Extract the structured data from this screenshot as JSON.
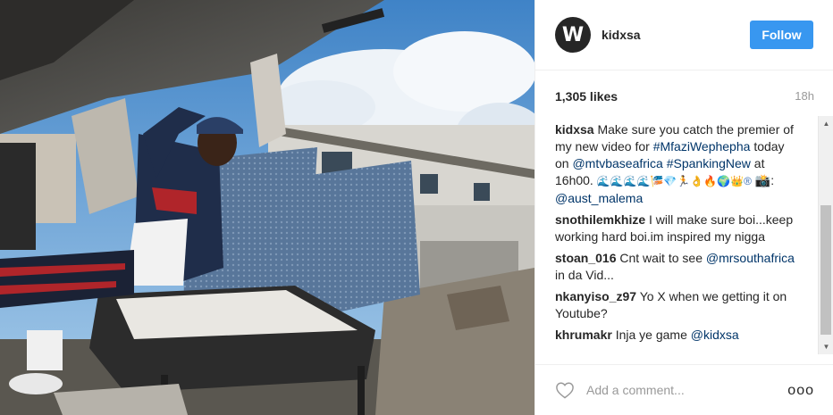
{
  "post": {
    "username": "kidxsa",
    "avatar_letter": "W",
    "follow_label": "Follow",
    "likes": "1,305 likes",
    "time": "18h"
  },
  "caption": {
    "author": "kidxsa",
    "text_1": "Make sure you catch the premier of my new video for",
    "hashtag_1": "#MfaziWephepha",
    "text_2": "today on",
    "mention_1": "@mtvbaseafrica",
    "hashtag_2": "#SpankingNew",
    "text_3": "at 16h00.",
    "emoji_text": "🌊🌊🌊🌊🎏💎🏃👌🔥🌍👑®",
    "text_4": "📸:",
    "mention_2": "@aust_malema"
  },
  "comments": [
    {
      "author": "snothilemkhize",
      "text": "I will make sure boi...keep working hard boi.im inspired my nigga"
    },
    {
      "author": "stoan_016",
      "text": "Cnt wait to see",
      "mention": "@mrsouthafrica",
      "text_after": "in da Vid..."
    },
    {
      "author": "nkanyiso_z97",
      "text": "Yo X when we getting it on Youtube?"
    },
    {
      "author": "khrumakr",
      "text": "Inja ye game",
      "mention": "@kidxsa"
    }
  ],
  "composer": {
    "placeholder": "Add a comment...",
    "heart_icon": "heart-outline-icon",
    "more_icon": "more-options-icon",
    "more_glyph": "ooo"
  },
  "colors": {
    "follow_bg": "#3897f0",
    "link": "#003569",
    "text": "#262626",
    "muted": "#999999"
  }
}
